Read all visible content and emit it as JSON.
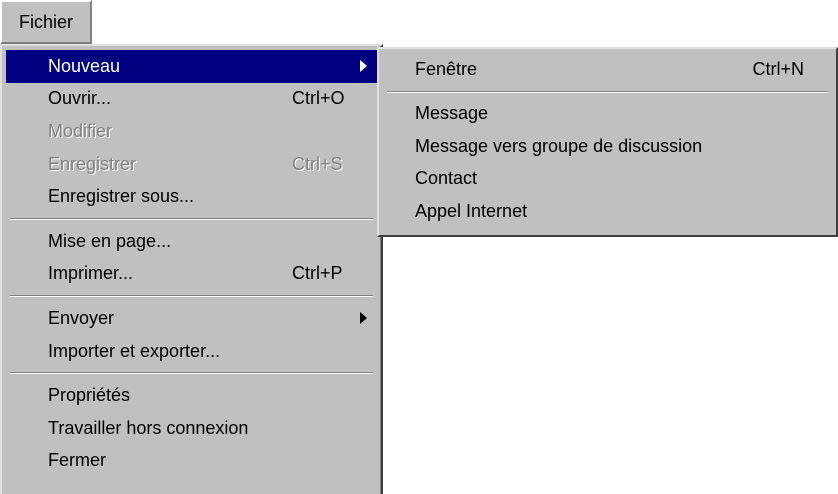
{
  "menubar": {
    "fichier_label": "Fichier"
  },
  "menu": {
    "items": [
      {
        "label": "Nouveau",
        "shortcut": "",
        "submenu": true,
        "state": "selected"
      },
      {
        "label": "Ouvrir...",
        "shortcut": "Ctrl+O",
        "state": "enabled"
      },
      {
        "label": "Modifier",
        "shortcut": "",
        "state": "disabled"
      },
      {
        "label": "Enregistrer",
        "shortcut": "Ctrl+S",
        "state": "disabled"
      },
      {
        "label": "Enregistrer sous...",
        "shortcut": "",
        "state": "enabled"
      },
      {
        "label": "Mise en page...",
        "shortcut": "",
        "state": "enabled"
      },
      {
        "label": "Imprimer...",
        "shortcut": "Ctrl+P",
        "state": "enabled"
      },
      {
        "label": "Envoyer",
        "shortcut": "",
        "submenu": true,
        "state": "enabled"
      },
      {
        "label": "Importer et exporter...",
        "shortcut": "",
        "state": "enabled"
      },
      {
        "label": "Propriétés",
        "shortcut": "",
        "state": "enabled"
      },
      {
        "label": "Travailler hors connexion",
        "shortcut": "",
        "state": "enabled"
      },
      {
        "label": "Fermer",
        "shortcut": "",
        "state": "enabled"
      }
    ]
  },
  "submenu": {
    "items": [
      {
        "label": "Fenêtre",
        "shortcut": "Ctrl+N"
      },
      {
        "label": "Message",
        "shortcut": ""
      },
      {
        "label": "Message vers groupe de discussion",
        "shortcut": ""
      },
      {
        "label": "Contact",
        "shortcut": ""
      },
      {
        "label": "Appel Internet",
        "shortcut": ""
      }
    ]
  },
  "colors": {
    "menu_face": "#c0c0c0",
    "highlight": "#000080",
    "highlight_text": "#ffffff",
    "disabled_text": "#808080"
  }
}
